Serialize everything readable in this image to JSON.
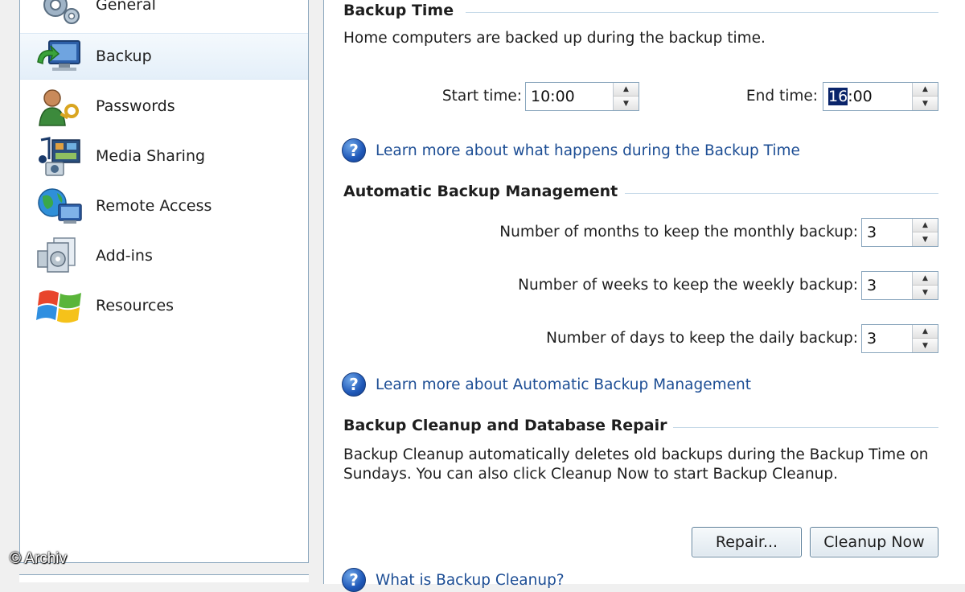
{
  "sidebar": {
    "items": [
      {
        "label": "General",
        "icon": "gears-icon",
        "selected": false
      },
      {
        "label": "Backup",
        "icon": "backup-monitor-icon",
        "selected": true
      },
      {
        "label": "Passwords",
        "icon": "user-key-icon",
        "selected": false
      },
      {
        "label": "Media Sharing",
        "icon": "media-icon",
        "selected": false
      },
      {
        "label": "Remote Access",
        "icon": "globe-monitor-icon",
        "selected": false
      },
      {
        "label": "Add-ins",
        "icon": "addins-icon",
        "selected": false
      },
      {
        "label": "Resources",
        "icon": "windows-logo-icon",
        "selected": false
      }
    ]
  },
  "backup_time": {
    "heading": "Backup Time",
    "description": "Home computers are backed up during the backup time.",
    "start_label": "Start time:",
    "start_value": "10:00",
    "end_label": "End time:",
    "end_value_selected": "16",
    "end_value_rest": ":00",
    "help_link": "Learn more about what happens during the Backup Time"
  },
  "auto_mgmt": {
    "heading": "Automatic Backup Management",
    "months_label": "Number of months to keep the monthly backup:",
    "months_value": "3",
    "weeks_label": "Number of weeks to keep the weekly backup:",
    "weeks_value": "3",
    "days_label": "Number of days to keep the daily backup:",
    "days_value": "3",
    "help_link": "Learn more about Automatic Backup Management"
  },
  "cleanup": {
    "heading": "Backup Cleanup and Database Repair",
    "desc_line1": "Backup Cleanup automatically deletes old backups during the Backup Time on",
    "desc_line2": "Sundays.  You can also click Cleanup Now to start Backup Cleanup.",
    "repair_label": "Repair...",
    "cleanup_label": "Cleanup Now",
    "help_link": "What is Backup Cleanup?"
  },
  "watermark": "© Archiv",
  "colors": {
    "accent_link": "#1c4d94",
    "border": "#8aa6bd",
    "selection": "#0a246a"
  }
}
